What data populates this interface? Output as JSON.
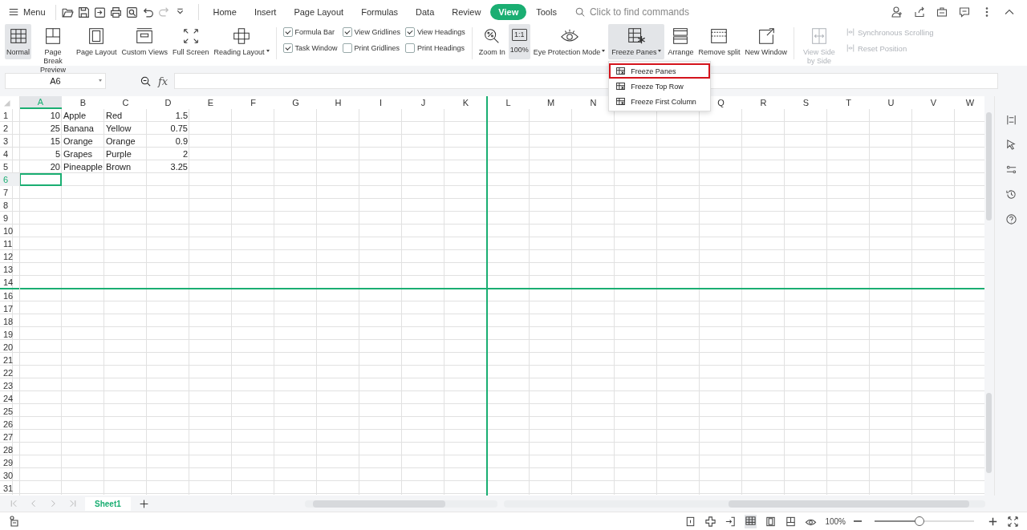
{
  "topbar": {
    "menu": "Menu",
    "tabs": [
      {
        "label": "Home",
        "selected": false
      },
      {
        "label": "Insert",
        "selected": false
      },
      {
        "label": "Page Layout",
        "selected": false
      },
      {
        "label": "Formulas",
        "selected": false
      },
      {
        "label": "Data",
        "selected": false
      },
      {
        "label": "Review",
        "selected": false
      },
      {
        "label": "View",
        "selected": true
      },
      {
        "label": "Tools",
        "selected": false
      }
    ],
    "search": {
      "placeholder": "Click to find commands"
    }
  },
  "ribbon": [
    {
      "kind": "big",
      "label": "Normal",
      "selected": true
    },
    {
      "kind": "big",
      "label": "Page Break Preview",
      "selected": false
    },
    {
      "kind": "big",
      "label": "Page Layout",
      "selected": false
    },
    {
      "kind": "big",
      "label": "Custom Views",
      "selected": false
    },
    {
      "kind": "big",
      "label": "Full Screen",
      "selected": false
    },
    {
      "kind": "big",
      "label": "Reading Layout",
      "selected": false,
      "dropdown": true
    },
    {
      "kind": "checks",
      "items": [
        {
          "label": "Formula Bar",
          "checked": true
        },
        {
          "label": "Task Window",
          "checked": true
        }
      ]
    },
    {
      "kind": "checks",
      "items": [
        {
          "label": "View Gridlines",
          "checked": true
        },
        {
          "label": "Print Gridlines",
          "checked": false
        }
      ]
    },
    {
      "kind": "checks",
      "items": [
        {
          "label": "View Headings",
          "checked": true
        },
        {
          "label": "Print Headings",
          "checked": false
        }
      ]
    },
    {
      "kind": "big",
      "label": "Zoom In",
      "selected": false
    },
    {
      "kind": "big",
      "label": "100%",
      "icon_text": "1:1",
      "selected": true
    },
    {
      "kind": "big",
      "label": "Eye Protection Mode",
      "selected": false,
      "dropdown": true
    },
    {
      "kind": "big",
      "label": "Freeze Panes",
      "selected": true,
      "dropdown": true,
      "menu": [
        {
          "label": "Freeze Panes",
          "selected": true
        },
        {
          "label": "Freeze Top Row",
          "selected": false
        },
        {
          "label": "Freeze First Column",
          "selected": false
        }
      ]
    },
    {
      "kind": "big",
      "label": "Arrange",
      "selected": false
    },
    {
      "kind": "big",
      "label": "Remove split",
      "selected": false
    },
    {
      "kind": "big",
      "label": "New Window",
      "selected": false
    },
    {
      "kind": "big",
      "label": "View Side by Side",
      "selected": false,
      "disabled": true
    },
    {
      "kind": "smalls",
      "items": [
        {
          "label": "Synchronous Scrolling",
          "disabled": true
        },
        {
          "label": "Reset Position",
          "disabled": true
        }
      ]
    }
  ],
  "formula_bar": {
    "name_box": "A6",
    "fx": "fx"
  },
  "grid": {
    "columns": [
      {
        "label": "A",
        "selected": true,
        "right_aligned": true
      },
      {
        "label": "B",
        "selected": false,
        "right_aligned": false
      },
      {
        "label": "C",
        "selected": false,
        "right_aligned": false
      },
      {
        "label": "D",
        "selected": false,
        "right_aligned": true
      },
      {
        "label": "E",
        "selected": false
      },
      {
        "label": "F",
        "selected": false
      },
      {
        "label": "G",
        "selected": false
      },
      {
        "label": "H",
        "selected": false
      },
      {
        "label": "I",
        "selected": false
      },
      {
        "label": "J",
        "selected": false
      },
      {
        "label": "K",
        "selected": false,
        "freeze_after": true
      },
      {
        "label": "L",
        "selected": false
      },
      {
        "label": "M",
        "selected": false
      },
      {
        "label": "N",
        "selected": false
      },
      {},
      {},
      {
        "label": "Q",
        "selected": false
      },
      {
        "label": "R",
        "selected": false
      },
      {
        "label": "S",
        "selected": false
      },
      {
        "label": "T",
        "selected": false
      },
      {
        "label": "U",
        "selected": false
      },
      {
        "label": "V",
        "selected": false
      },
      {
        "label": "W",
        "selected": false
      }
    ],
    "rows": [
      {
        "header": "1",
        "selected": false,
        "cells": [
          "10",
          "Apple",
          "Red",
          "1.5"
        ]
      },
      {
        "header": "2",
        "selected": false,
        "cells": [
          "25",
          "Banana",
          "Yellow",
          "0.75"
        ]
      },
      {
        "header": "3",
        "selected": false,
        "cells": [
          "15",
          "Orange",
          "Orange",
          "0.9"
        ]
      },
      {
        "header": "4",
        "selected": false,
        "cells": [
          "5",
          "Grapes",
          "Purple",
          "2"
        ]
      },
      {
        "header": "5",
        "selected": false,
        "cells": [
          "20",
          "Pineapple",
          "Brown",
          "3.25"
        ]
      },
      {
        "header": "6",
        "selected": true
      },
      {
        "header": "7",
        "selected": false
      },
      {
        "header": "8",
        "selected": false
      },
      {
        "header": "9",
        "selected": false
      },
      {
        "header": "10",
        "selected": false
      },
      {
        "header": "11",
        "selected": false
      },
      {
        "header": "12",
        "selected": false
      },
      {
        "header": "13",
        "selected": false
      },
      {
        "header": "14",
        "selected": false,
        "freeze_below": true
      },
      {
        "header": "16",
        "selected": false
      },
      {
        "header": "17",
        "selected": false
      },
      {
        "header": "18",
        "selected": false
      },
      {
        "header": "19",
        "selected": false
      },
      {
        "header": "20",
        "selected": false
      },
      {
        "header": "21",
        "selected": false
      },
      {
        "header": "22",
        "selected": false
      },
      {
        "header": "23",
        "selected": false
      },
      {
        "header": "24",
        "selected": false
      },
      {
        "header": "25",
        "selected": false
      },
      {
        "header": "26",
        "selected": false
      },
      {
        "header": "27",
        "selected": false
      },
      {
        "header": "28",
        "selected": false
      },
      {
        "header": "29",
        "selected": false
      },
      {
        "header": "30",
        "selected": false
      },
      {
        "header": "31",
        "selected": false
      }
    ]
  },
  "sheet_tabs": [
    {
      "label": "Sheet1",
      "selected": true
    }
  ],
  "status_bar": {
    "zoom": "100%",
    "zoom_slider": {
      "level": 0.45
    }
  }
}
